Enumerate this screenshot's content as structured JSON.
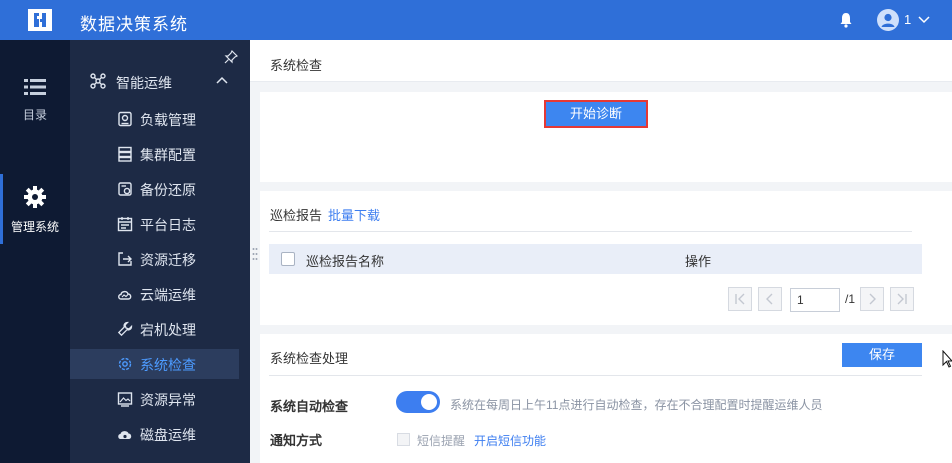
{
  "app": {
    "title": "数据决策系统"
  },
  "user": {
    "name": "1"
  },
  "rail": {
    "items": [
      {
        "label": "目录",
        "icon": "list-icon"
      },
      {
        "label": "管理系统",
        "icon": "gear-icon",
        "active": true
      }
    ]
  },
  "sidebar": {
    "group": {
      "label": "智能运维",
      "icon": "nodes-icon",
      "expanded": true
    },
    "items": [
      {
        "label": "负载管理",
        "icon": "load-icon"
      },
      {
        "label": "集群配置",
        "icon": "server-icon"
      },
      {
        "label": "备份还原",
        "icon": "backup-icon"
      },
      {
        "label": "平台日志",
        "icon": "calendar-icon"
      },
      {
        "label": "资源迁移",
        "icon": "migrate-icon"
      },
      {
        "label": "云端运维",
        "icon": "cloud-icon"
      },
      {
        "label": "宕机处理",
        "icon": "wrench-icon"
      },
      {
        "label": "系统检查",
        "icon": "gear-check-icon",
        "active": true
      },
      {
        "label": "资源异常",
        "icon": "image-alert-icon"
      },
      {
        "label": "磁盘运维",
        "icon": "disk-icon"
      }
    ]
  },
  "page": {
    "title": "系统检查"
  },
  "diagnose": {
    "button_label": "开始诊断"
  },
  "report": {
    "tab_label": "巡检报告",
    "batch_download_label": "批量下载",
    "columns": [
      "巡检报告名称",
      "操作"
    ],
    "rows": [],
    "pagination": {
      "current": "1",
      "total": "/1"
    }
  },
  "processing": {
    "title": "系统检查处理",
    "save_label": "保存",
    "auto_check": {
      "label": "系统自动检查",
      "enabled": true,
      "hint": "系统在每周日上午11点进行自动检查，存在不合理配置时提醒运维人员"
    },
    "notify": {
      "label": "通知方式",
      "sms_label": "短信提醒",
      "sms_checked": false,
      "enable_sms_link": "开启短信功能"
    }
  },
  "colors": {
    "primary": "#2f6fd8",
    "accent": "#3d86f0",
    "rail_bg": "#0e1a33",
    "sidebar_bg": "#1d2a45",
    "highlight_border": "#e53935"
  }
}
